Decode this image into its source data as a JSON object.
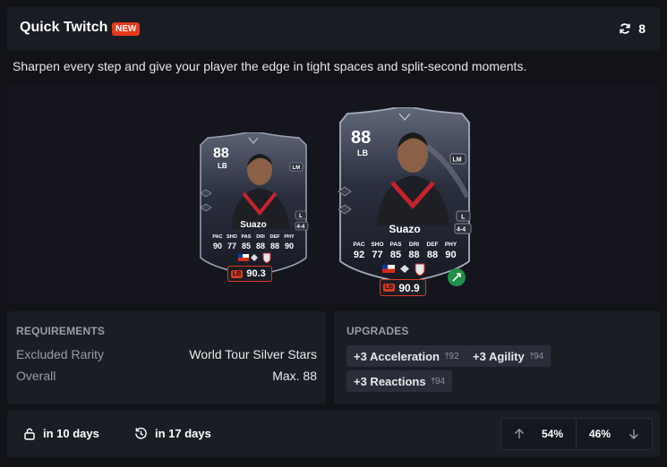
{
  "header": {
    "title": "Quick Twitch",
    "badge": "NEW",
    "count": "8"
  },
  "description": "Sharpen every step and give your player the edge in tight spaces and split-second moments.",
  "cards": [
    {
      "rating": "88",
      "position": "LB",
      "name": "Suazo",
      "alt_position": "LM",
      "foot": "L",
      "formation": "4-4",
      "stat_labels": [
        "PAC",
        "SHO",
        "PAS",
        "DRI",
        "DEF",
        "PHY"
      ],
      "stat_values": [
        "90",
        "77",
        "85",
        "88",
        "88",
        "90"
      ],
      "score_pos": "LB",
      "score": "90.3"
    },
    {
      "rating": "88",
      "position": "LB",
      "name": "Suazo",
      "alt_position": "LM",
      "foot": "L",
      "formation": "4-4",
      "stat_labels": [
        "PAC",
        "SHO",
        "PAS",
        "DRI",
        "DEF",
        "PHY"
      ],
      "stat_values": [
        "92",
        "77",
        "85",
        "88",
        "88",
        "90"
      ],
      "score_pos": "LB",
      "score": "90.9"
    }
  ],
  "requirements": {
    "title": "REQUIREMENTS",
    "rows": [
      {
        "label": "Excluded Rarity",
        "value": "World Tour Silver Stars"
      },
      {
        "label": "Overall",
        "value": "Max. 88"
      }
    ]
  },
  "upgrades": {
    "title": "UPGRADES",
    "items": [
      {
        "label": "+3 Acceleration",
        "cap": "92"
      },
      {
        "label": "+3 Agility",
        "cap": "94"
      },
      {
        "label": "+3 Reactions",
        "cap": "94"
      }
    ]
  },
  "footer": {
    "unlock": "in 10 days",
    "expires": "in 17 days",
    "upvote": "54%",
    "downvote": "46%"
  },
  "colors": {
    "accent": "#e5391c",
    "background": "#121319",
    "panel": "#1b1d25"
  }
}
